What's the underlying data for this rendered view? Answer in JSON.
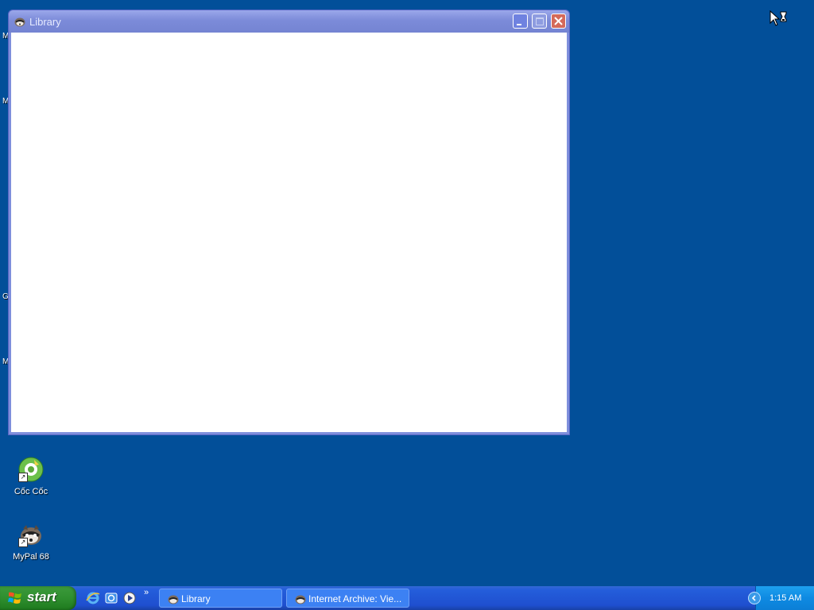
{
  "window": {
    "title": "Library",
    "minimize_icon": "minimize-icon",
    "maximize_icon": "maximize-icon",
    "close_icon": "close-icon"
  },
  "desktop": {
    "edge_letters": [
      "M",
      "M",
      "G",
      "M"
    ],
    "icons": [
      {
        "label": "Cốc Cốc",
        "icon": "coccoc-icon"
      },
      {
        "label": "MyPal 68",
        "icon": "mypal-icon"
      }
    ]
  },
  "taskbar": {
    "start_label": "start",
    "quick_launch": [
      "ie-icon",
      "outlook-icon",
      "media-player-icon"
    ],
    "quick_launch_more": "»",
    "tasks": [
      {
        "label": "Library",
        "icon": "mypal-icon"
      },
      {
        "label": "Internet Archive: Vie...",
        "icon": "mypal-icon"
      }
    ],
    "clock": "1:15 AM"
  },
  "colors": {
    "desktop": "#024f99",
    "taskbar": "#245edb",
    "start": "#2f8f2f",
    "tray": "#0e8ae2",
    "window_title": "#7f8fdc"
  }
}
